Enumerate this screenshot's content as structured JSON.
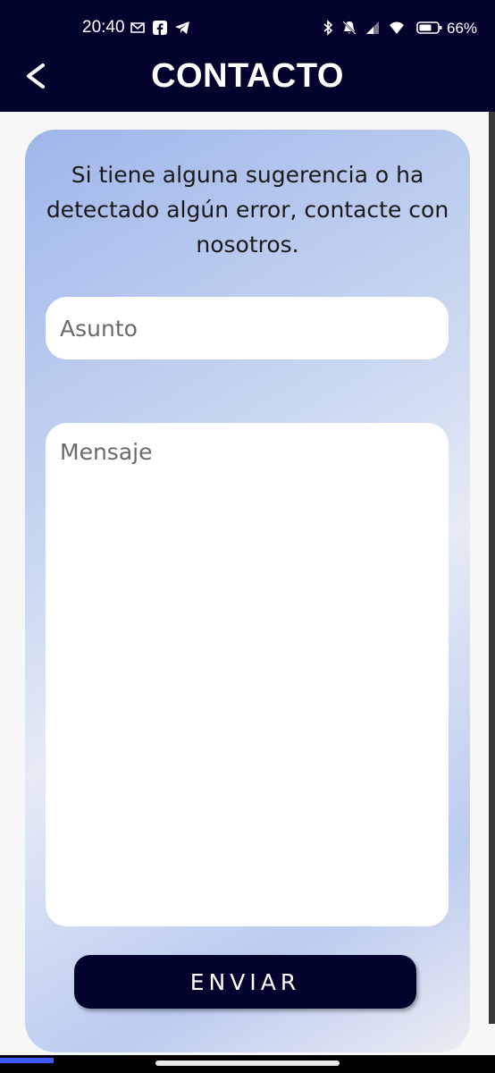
{
  "status_bar": {
    "time": "20:40",
    "battery_percent": "66%",
    "icons": [
      "gmail-icon",
      "facebook-icon",
      "telegram-icon",
      "bluetooth-icon",
      "mute-bell-icon",
      "cell-signal-icon",
      "wifi-icon",
      "battery-icon"
    ]
  },
  "header": {
    "back_icon": "chevron-left-icon",
    "title": "CONTACTO",
    "background_color": "#02042e"
  },
  "form": {
    "intro_text": "Si tiene alguna sugerencia o ha detectado algún error, contacte con nosotros.",
    "subject_placeholder": "Asunto",
    "subject_value": "",
    "message_placeholder": "Mensaje",
    "message_value": "",
    "send_label": "ENVIAR"
  },
  "colors": {
    "accent": "#02042e",
    "card_gradient_start": "#9fb6ea",
    "card_gradient_end": "#e9ecf1"
  }
}
